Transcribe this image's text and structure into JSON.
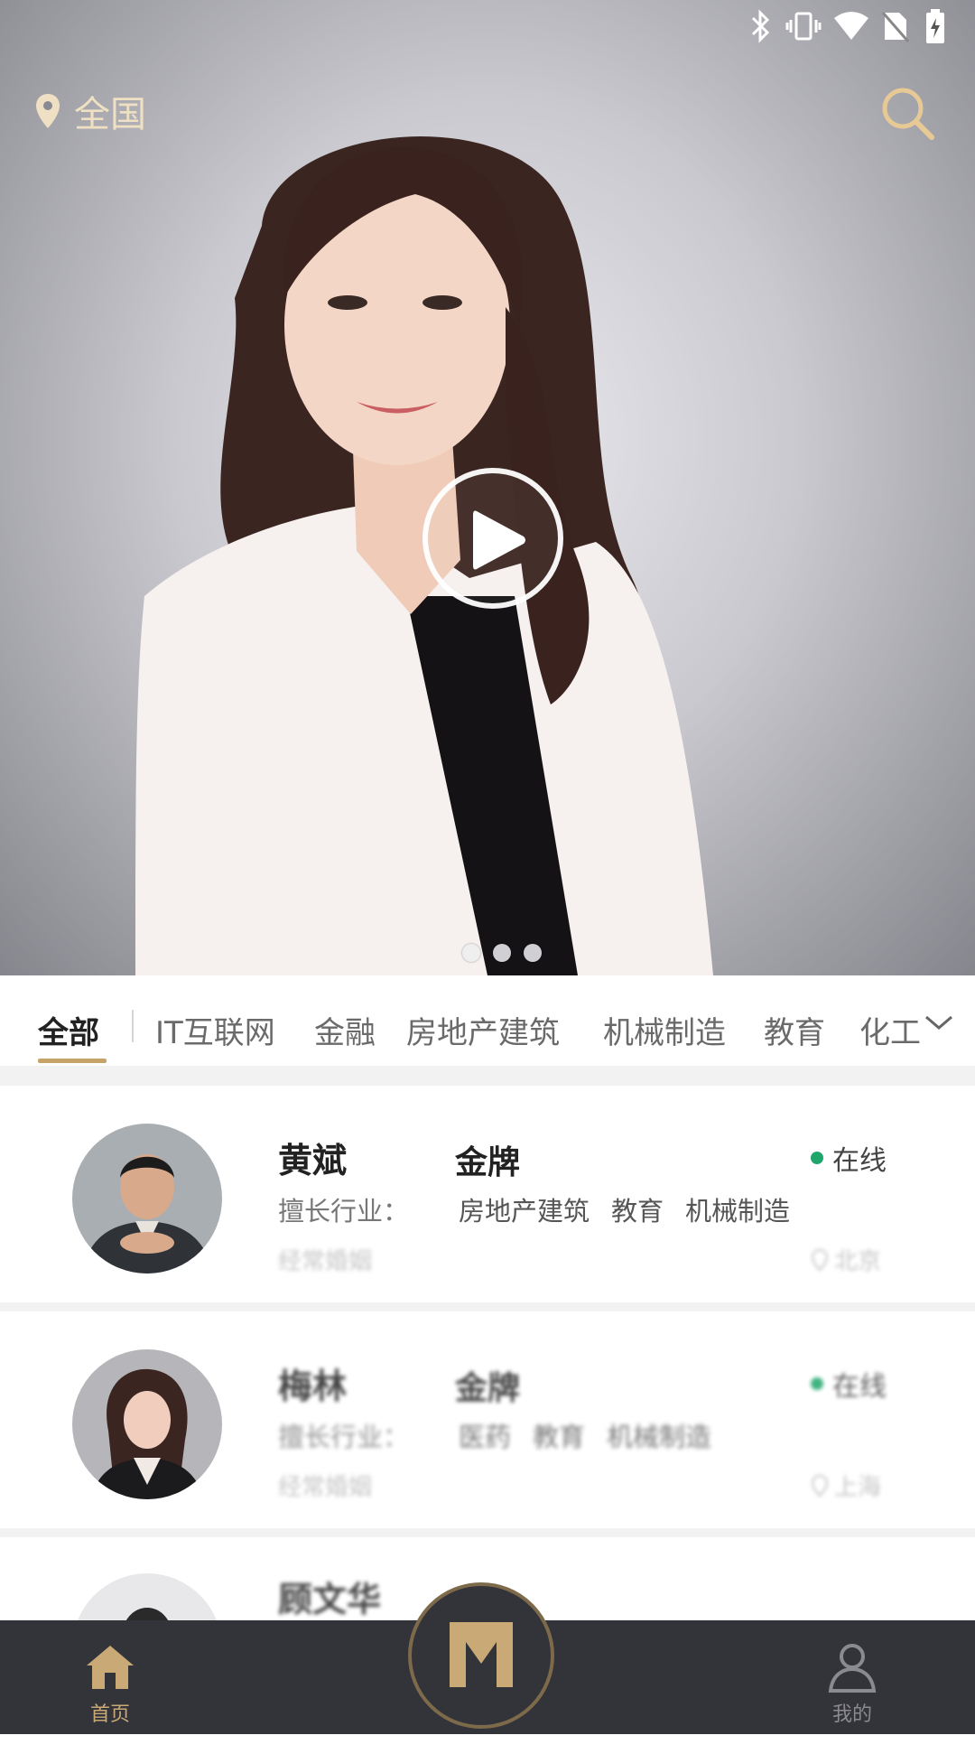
{
  "header": {
    "location_label": "全国",
    "status_icons": [
      "bluetooth-icon",
      "vibrate-icon",
      "wifi-icon",
      "no-sim-icon",
      "battery-charging-icon"
    ]
  },
  "banner": {
    "play_icon": "play-icon",
    "page_count": 3,
    "active_page": 1
  },
  "categories": {
    "items": [
      "全部",
      "IT互联网",
      "金融",
      "房地产建筑",
      "机械制造",
      "教育",
      "化工"
    ],
    "selected": "全部",
    "more_icon": "chevron-down-icon"
  },
  "advisors": [
    {
      "name": "黄斌",
      "level": "金牌",
      "status": "在线",
      "expertise_label": "擅长行业：",
      "industries": [
        "房地产建筑",
        "教育",
        "机械制造"
      ],
      "subtitle": "经常婚姻",
      "city": "北京"
    },
    {
      "name": "梅林",
      "level": "金牌",
      "status": "在线",
      "expertise_label": "擅长行业：",
      "industries": [
        "医药",
        "教育",
        "机械制造"
      ],
      "subtitle": "经常婚姻",
      "city": "上海"
    },
    {
      "name": "顾文华"
    }
  ],
  "bottom_nav": {
    "home_label": "首页",
    "mine_label": "我的"
  },
  "colors": {
    "accent_gold": "#c7a36a",
    "online_green": "#1fa66a",
    "nav_bg": "#33333a"
  }
}
